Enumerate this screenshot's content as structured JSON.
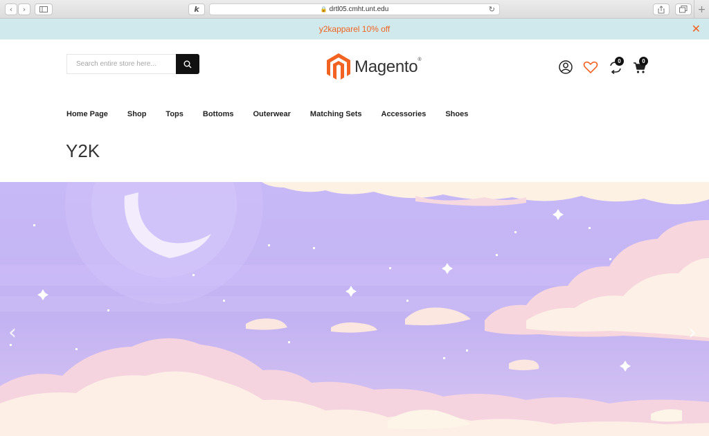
{
  "browser": {
    "url": "drtl05.cmht.unt.edu",
    "back_icon": "chevron-left-icon",
    "forward_icon": "chevron-right-icon"
  },
  "promo": {
    "text": "y2kapparel 10% off",
    "close_icon": "close-icon"
  },
  "header": {
    "search_placeholder": "Search entire store here...",
    "logo_text": "Magento",
    "compare_count": "0",
    "cart_count": "0"
  },
  "nav": {
    "items": [
      "Home Page",
      "Shop",
      "Tops",
      "Bottoms",
      "Outerwear",
      "Matching Sets",
      "Accessories",
      "Shoes"
    ]
  },
  "page": {
    "title": "Y2K"
  },
  "banner": {
    "prev_icon": "chevron-left-icon",
    "next_icon": "chevron-right-icon"
  },
  "colors": {
    "accent": "#f26322",
    "promo_bg": "#cfe9ec",
    "sky": "#c6b6f5"
  }
}
